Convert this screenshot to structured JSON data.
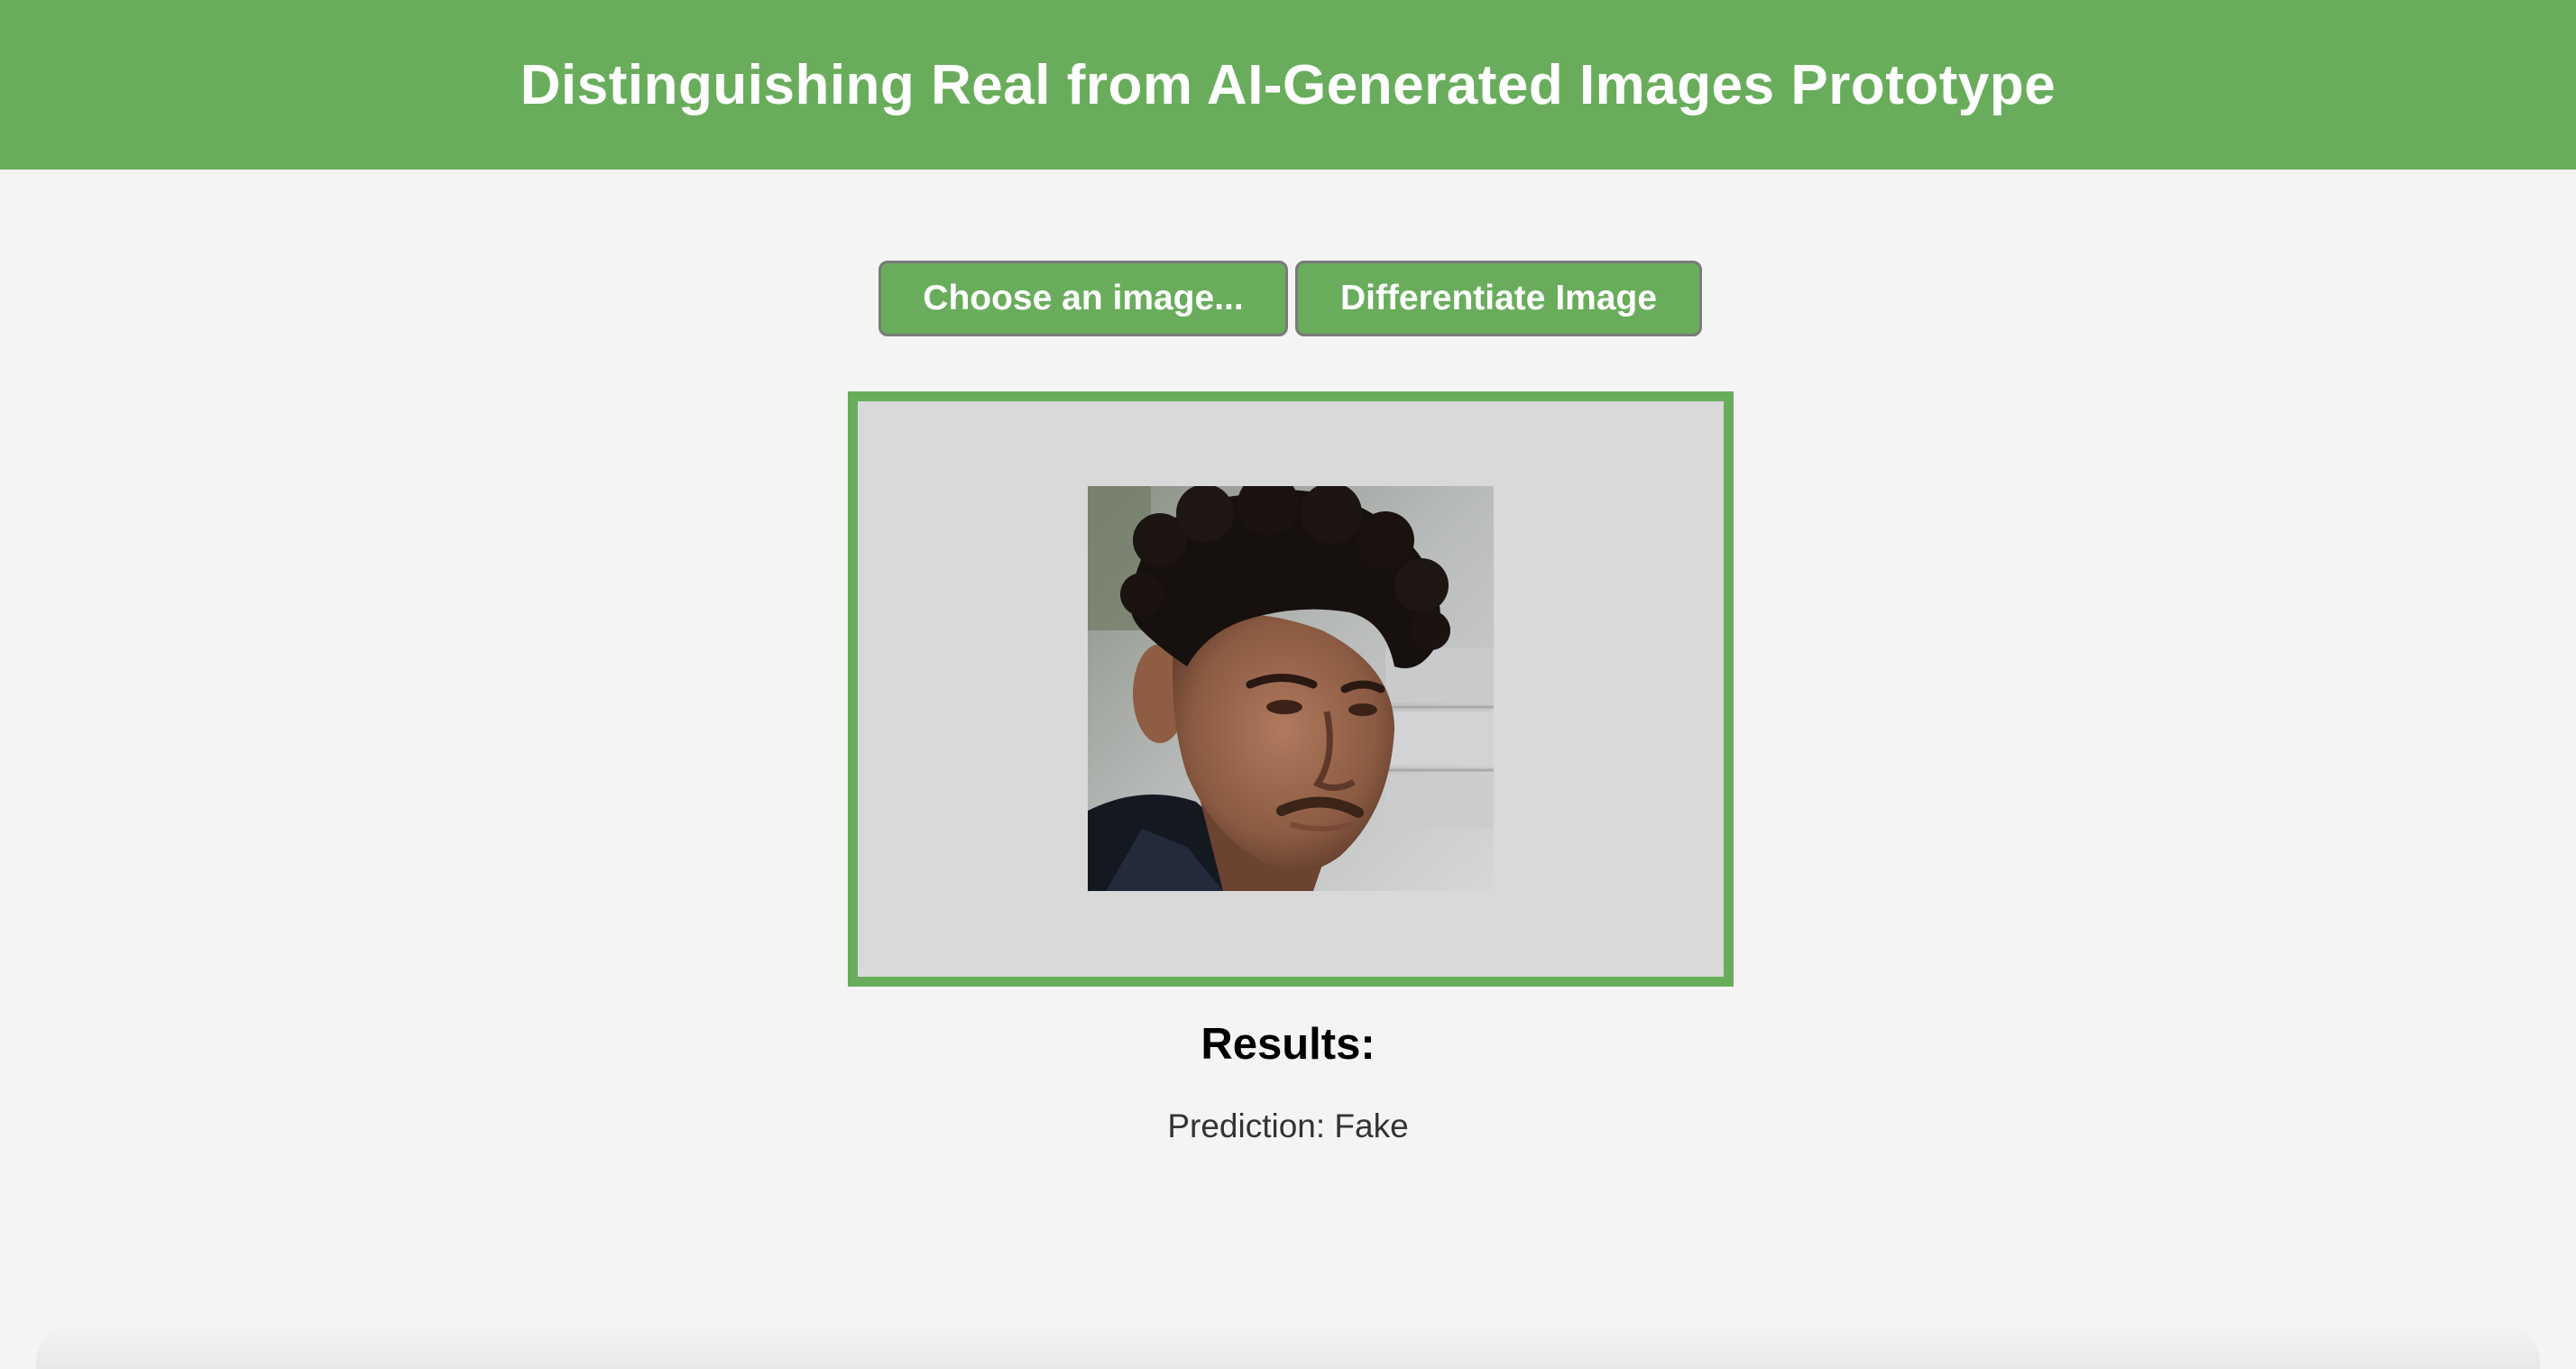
{
  "header": {
    "title": "Distinguishing Real from AI-Generated Images Prototype"
  },
  "controls": {
    "choose_label": "Choose an image...",
    "differentiate_label": "Differentiate Image"
  },
  "preview": {
    "image_alt": "uploaded portrait of a man with curly dark hair"
  },
  "results": {
    "title": "Results:",
    "prediction": "Prediction: Fake"
  },
  "colors": {
    "accent": "#69ad5c",
    "page_background": "#f4f4f4",
    "preview_background": "#d9d9d9"
  }
}
